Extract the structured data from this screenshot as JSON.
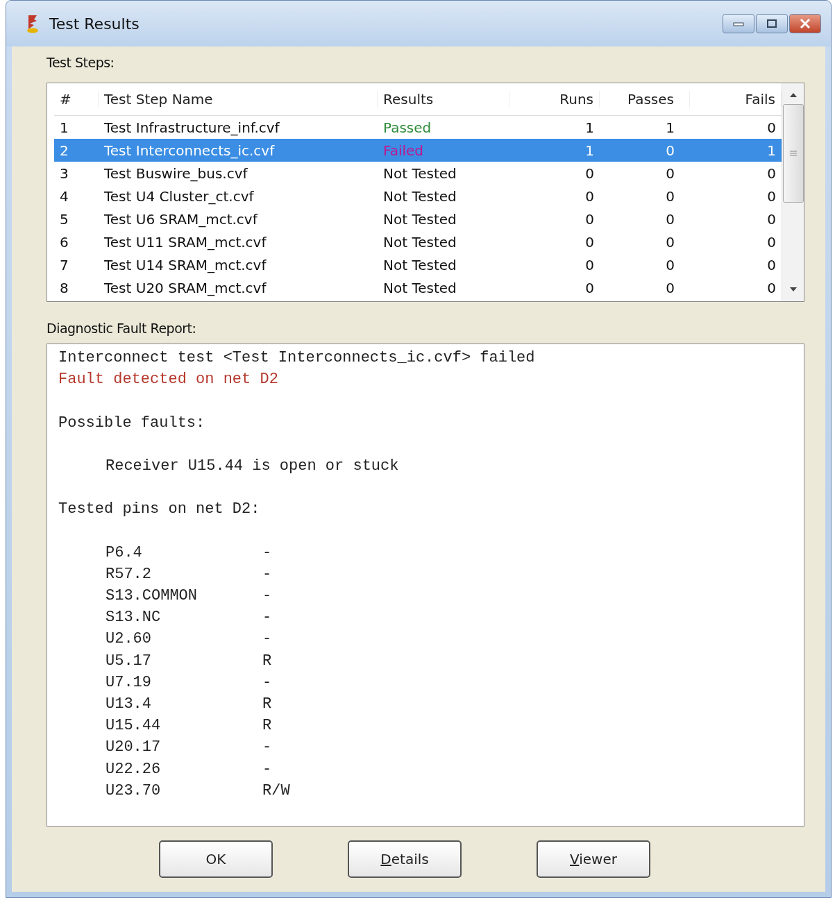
{
  "window": {
    "title": "Test Results"
  },
  "steps_label": "Test Steps:",
  "table": {
    "columns": [
      "#",
      "Test Step Name",
      "Results",
      "Runs",
      "Passes",
      "Fails"
    ],
    "rows": [
      {
        "cells": [
          "1",
          "Test Infrastructure_inf.cvf",
          "Passed",
          "1",
          "1",
          "0"
        ],
        "color": "#2e8b3a",
        "selected": false
      },
      {
        "cells": [
          "2",
          "Test Interconnects_ic.cvf",
          "Failed",
          "1",
          "0",
          "1"
        ],
        "color": "#c0178f",
        "selected": true
      },
      {
        "cells": [
          "3",
          "Test Buswire_bus.cvf",
          "Not Tested",
          "0",
          "0",
          "0"
        ],
        "color": "#111111",
        "selected": false
      },
      {
        "cells": [
          "4",
          "Test U4 Cluster_ct.cvf",
          "Not Tested",
          "0",
          "0",
          "0"
        ],
        "color": "#111111",
        "selected": false
      },
      {
        "cells": [
          "5",
          "Test U6 SRAM_mct.cvf",
          "Not Tested",
          "0",
          "0",
          "0"
        ],
        "color": "#111111",
        "selected": false
      },
      {
        "cells": [
          "6",
          "Test U11 SRAM_mct.cvf",
          "Not Tested",
          "0",
          "0",
          "0"
        ],
        "color": "#111111",
        "selected": false
      },
      {
        "cells": [
          "7",
          "Test U14 SRAM_mct.cvf",
          "Not Tested",
          "0",
          "0",
          "0"
        ],
        "color": "#111111",
        "selected": false
      },
      {
        "cells": [
          "8",
          "Test U20 SRAM_mct.cvf",
          "Not Tested",
          "0",
          "0",
          "0"
        ],
        "color": "#111111",
        "selected": false
      }
    ]
  },
  "report_label": "Diagnostic Fault Report:",
  "report": [
    {
      "kind": "text",
      "text": "Interconnect test <Test Interconnects_ic.cvf> failed"
    },
    {
      "kind": "fault",
      "text": "Fault detected on net D2"
    },
    {
      "kind": "blank"
    },
    {
      "kind": "text",
      "text": "Possible faults:"
    },
    {
      "kind": "blank"
    },
    {
      "kind": "indent",
      "text": "Receiver U15.44 is open or stuck"
    },
    {
      "kind": "blank"
    },
    {
      "kind": "text",
      "text": "Tested pins on net D2:"
    },
    {
      "kind": "blank"
    },
    {
      "kind": "pin",
      "pin": "P6.4",
      "flag": "-"
    },
    {
      "kind": "pin",
      "pin": "R57.2",
      "flag": "-"
    },
    {
      "kind": "pin",
      "pin": "S13.COMMON",
      "flag": "-"
    },
    {
      "kind": "pin",
      "pin": "S13.NC",
      "flag": "-"
    },
    {
      "kind": "pin",
      "pin": "U2.60",
      "flag": "-"
    },
    {
      "kind": "pin",
      "pin": "U5.17",
      "flag": "R"
    },
    {
      "kind": "pin",
      "pin": "U7.19",
      "flag": "-"
    },
    {
      "kind": "pin",
      "pin": "U13.4",
      "flag": "R"
    },
    {
      "kind": "pin",
      "pin": "U15.44",
      "flag": "R"
    },
    {
      "kind": "pin",
      "pin": "U20.17",
      "flag": "-"
    },
    {
      "kind": "pin",
      "pin": "U22.26",
      "flag": "-"
    },
    {
      "kind": "pin",
      "pin": "U23.70",
      "flag": "R/W"
    }
  ],
  "buttons": [
    {
      "label": "OK",
      "underline_first": false
    },
    {
      "label": "Details",
      "underline_first": true
    },
    {
      "label": "Viewer",
      "underline_first": true
    }
  ]
}
